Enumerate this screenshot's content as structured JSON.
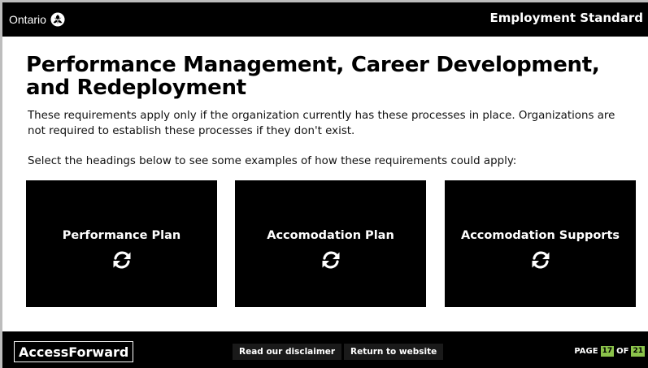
{
  "header": {
    "brand": "Ontario",
    "brand_logo": "trillium-logo",
    "document_title": "Employment Standard"
  },
  "main": {
    "title": "Performance Management, Career Development, and Redeployment",
    "intro": "These requirements apply only if the organization currently has these processes in place. Organizations are not required to establish these processes if they don't exist.",
    "instruction": "Select the headings below to see some examples of how these requirements could apply:",
    "cards": [
      {
        "label": "Performance Plan",
        "icon": "flip-refresh-icon"
      },
      {
        "label": "Accomodation Plan",
        "icon": "flip-refresh-icon"
      },
      {
        "label": "Accomodation Supports",
        "icon": "flip-refresh-icon"
      }
    ]
  },
  "footer": {
    "logo_text": "AccessForward",
    "disclaimer_label": "Read our disclaimer",
    "return_label": "Return to website",
    "page_prefix": "PAGE",
    "page_current": "17",
    "page_of": "OF",
    "page_total": "21"
  },
  "colors": {
    "bar_background": "#000000",
    "page_number_badge": "#8bc34a",
    "frame_border": "#bdbdbd"
  }
}
